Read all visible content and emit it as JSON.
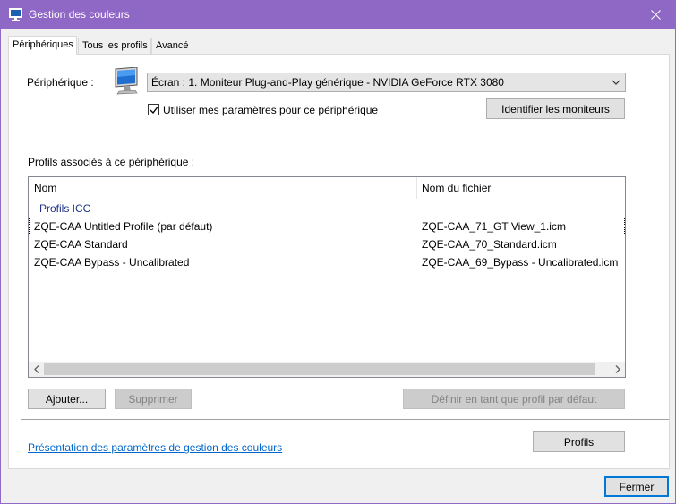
{
  "window": {
    "title": "Gestion des couleurs",
    "accent": "#8f67c5"
  },
  "tabs": [
    {
      "label": "Périphériques",
      "active": true
    },
    {
      "label": "Tous les profils",
      "active": false
    },
    {
      "label": "Avancé",
      "active": false
    }
  ],
  "device": {
    "label": "Périphérique :",
    "selected": "Écran : 1. Moniteur Plug-and-Play générique - NVIDIA GeForce RTX 3080",
    "use_settings_label": "Utiliser mes paramètres pour ce périphérique",
    "use_settings_checked": true,
    "identify_button": "Identifier les moniteurs"
  },
  "profiles": {
    "label": "Profils associés à ce périphérique :",
    "columns": [
      "Nom",
      "Nom du fichier"
    ],
    "group": "Profils ICC",
    "rows": [
      {
        "name": "ZQE-CAA Untitled Profile (par défaut)",
        "file": "ZQE-CAA_71_GT View_1.icm"
      },
      {
        "name": "ZQE-CAA Standard",
        "file": "ZQE-CAA_70_Standard.icm"
      },
      {
        "name": "ZQE-CAA Bypass - Uncalibrated",
        "file": "ZQE-CAA_69_Bypass - Uncalibrated.icm"
      }
    ]
  },
  "buttons": {
    "add": "Ajouter...",
    "remove": "Supprimer",
    "set_default": "Définir en tant que profil par défaut",
    "profiles": "Profils",
    "close": "Fermer"
  },
  "link": {
    "text": "Présentation des paramètres de gestion des couleurs"
  }
}
